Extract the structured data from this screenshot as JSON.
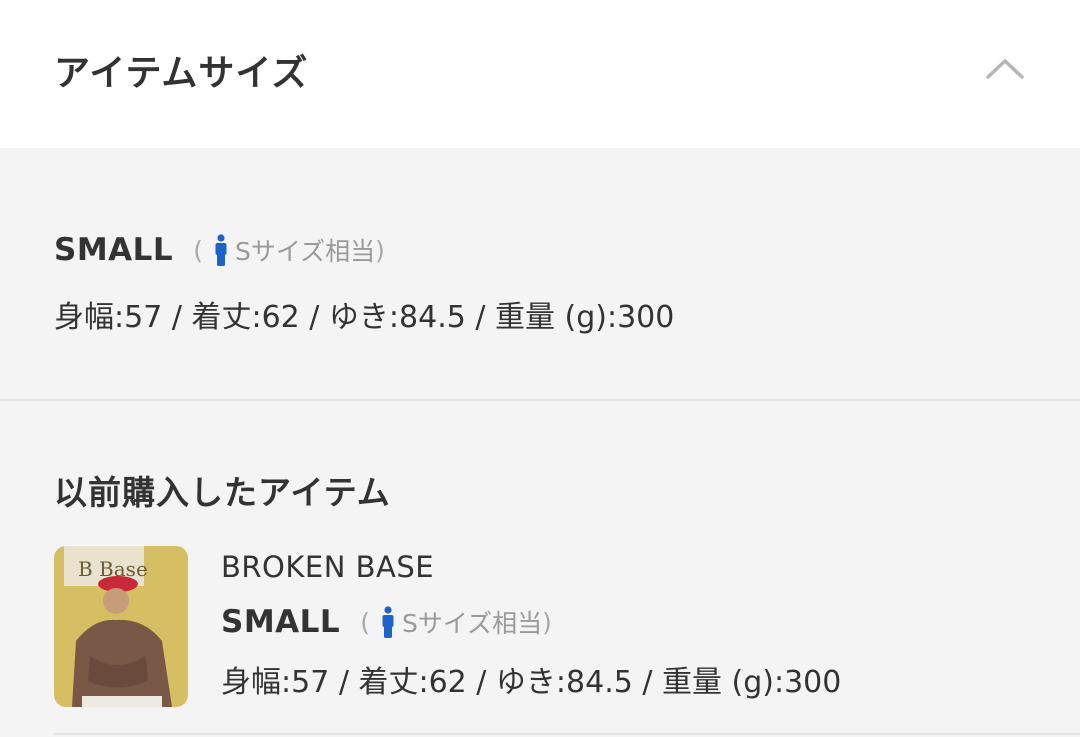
{
  "header": {
    "title": "アイテムサイズ",
    "collapse_icon": "chevron-up-icon"
  },
  "size": {
    "name": "SMALL",
    "equivalent_open": "(",
    "equivalent_label": "Sサイズ相当",
    "equivalent_close": ")",
    "person_icon": "person-icon",
    "measurements": "身幅:57 / 着丈:62 / ゆき:84.5 / 重量 (g):300"
  },
  "previous": {
    "title": "以前購入したアイテム",
    "item": {
      "brand": "BROKEN BASE",
      "size_name": "SMALL",
      "equivalent_open": "(",
      "equivalent_label": "Sサイズ相当",
      "equivalent_close": ")",
      "measurements": "身幅:57 / 着丈:62 / ゆき:84.5 / 重量 (g):300",
      "thumbnail_text": "B Base"
    }
  },
  "colors": {
    "accent_person_icon": "#1e64c8",
    "background": "#f4f4f4",
    "header_background": "#ffffff"
  }
}
